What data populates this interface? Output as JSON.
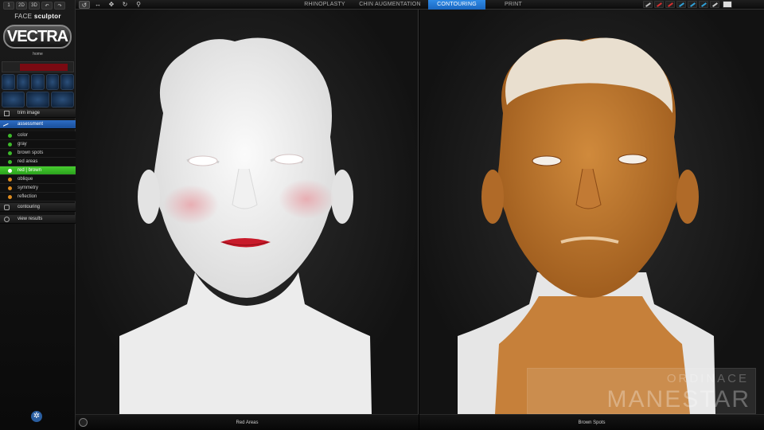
{
  "app": {
    "brand_prefix": "FACE",
    "brand_name": "sculptor",
    "logo_text": "VECTRA",
    "home_label": "home"
  },
  "toolbar": {
    "mini_buttons": [
      "1",
      "2D",
      "3D"
    ],
    "tools": [
      "select-icon",
      "move-icon",
      "pan-icon",
      "rotate-icon",
      "zoom-icon"
    ]
  },
  "tabs": [
    {
      "label": "RHINOPLASTY",
      "active": false
    },
    {
      "label": "CHIN AUGMENTATION",
      "active": false
    },
    {
      "label": "CONTOURING",
      "active": true
    },
    {
      "label": "PRINT",
      "active": false
    }
  ],
  "right_tools": {
    "colors": [
      "#bbbbbb",
      "#d83030",
      "#d83030",
      "#30a0d8",
      "#30a0d8",
      "#30a0d8",
      "#cccccc"
    ]
  },
  "sidebar": {
    "items": [
      {
        "label": "trim image",
        "active": false
      },
      {
        "label": "assessment",
        "active": true
      }
    ],
    "subitems": [
      {
        "label": "color",
        "style": "green"
      },
      {
        "label": "gray",
        "style": "green"
      },
      {
        "label": "brown spots",
        "style": "green"
      },
      {
        "label": "red areas",
        "style": "green"
      },
      {
        "label": "red | brown",
        "style": "selected"
      },
      {
        "label": "oblique",
        "style": "orange"
      },
      {
        "label": "symmetry",
        "style": "orange"
      },
      {
        "label": "reflection",
        "style": "orange"
      }
    ],
    "footer_items": [
      {
        "label": "contouring"
      },
      {
        "label": "view results"
      }
    ]
  },
  "viewports": {
    "left_label": "Red Areas",
    "right_label": "Brown Spots"
  },
  "watermark": {
    "line1": "ORDINACE",
    "line2": "MANESTAR"
  }
}
